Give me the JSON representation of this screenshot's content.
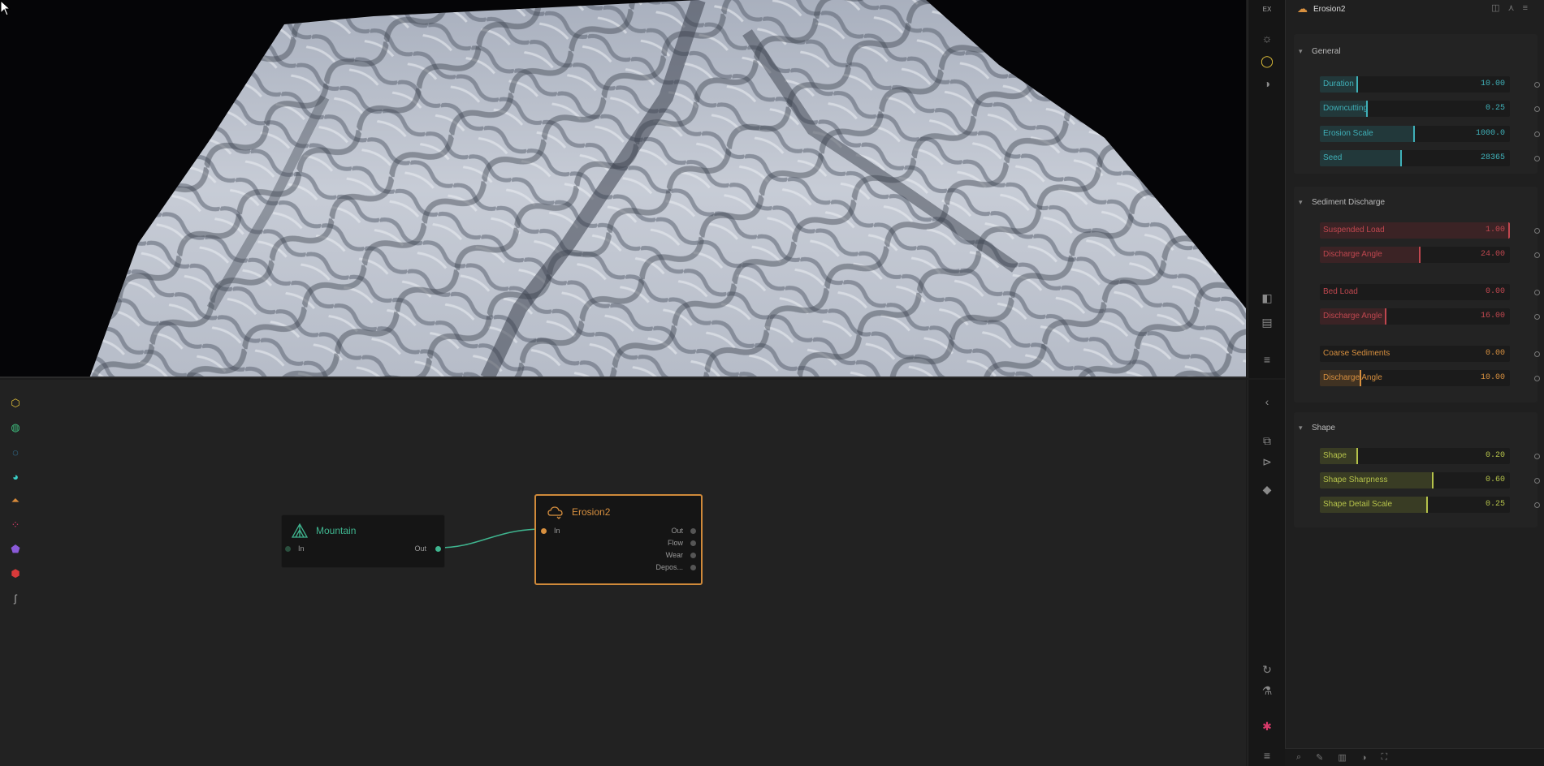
{
  "viewport": {
    "corner_label": "EX"
  },
  "graph": {
    "nodes": {
      "mountain": {
        "title": "Mountain",
        "in_label": "In",
        "out_label": "Out"
      },
      "erosion": {
        "title": "Erosion2",
        "in_label": "In",
        "outputs": [
          "Out",
          "Flow",
          "Wear",
          "Depos..."
        ]
      }
    },
    "left_tools": [
      {
        "icon": "cube-icon",
        "color": "#e3c23a"
      },
      {
        "icon": "globe-icon",
        "color": "#3fbf7f"
      },
      {
        "icon": "swirl-icon",
        "color": "#3aa0d8"
      },
      {
        "icon": "palette-icon",
        "color": "#3ad0c8"
      },
      {
        "icon": "mountain-layers-icon",
        "color": "#d88a3a"
      },
      {
        "icon": "scatter-icon",
        "color": "#d83a6a"
      },
      {
        "icon": "shield-icon",
        "color": "#8a5ad8"
      },
      {
        "icon": "gem-icon",
        "color": "#d83a3a"
      },
      {
        "icon": "curve-icon",
        "color": "#aaaaaa"
      }
    ]
  },
  "props": {
    "header": {
      "title": "Erosion2"
    },
    "sections": [
      {
        "title": "General",
        "rows": [
          {
            "label": "Duration",
            "value": "10.00",
            "fill": 0.2,
            "color": "#3fb0b8"
          },
          {
            "label": "Downcutting",
            "value": "0.25",
            "fill": 0.25,
            "color": "#3fb0b8"
          },
          {
            "label": "Erosion Scale",
            "value": "1000.0",
            "fill": 0.5,
            "color": "#3fb0b8"
          },
          {
            "label": "Seed",
            "value": "28365",
            "fill": 0.43,
            "color": "#3fb0b8"
          }
        ]
      },
      {
        "title": "Sediment Discharge",
        "rows": [
          {
            "label": "Suspended Load",
            "value": "1.00",
            "fill": 1.0,
            "color": "#c0474f"
          },
          {
            "label": "Discharge Angle",
            "value": "24.00",
            "fill": 0.53,
            "color": "#c0474f"
          },
          {
            "label": "Bed Load",
            "value": "0.00",
            "fill": 0.0,
            "color": "#c0474f"
          },
          {
            "label": "Discharge Angle",
            "value": "16.00",
            "fill": 0.35,
            "color": "#c0474f"
          },
          {
            "label": "Coarse Sediments",
            "value": "0.00",
            "fill": 0.0,
            "color": "#d8903f"
          },
          {
            "label": "Discharge Angle",
            "value": "10.00",
            "fill": 0.22,
            "color": "#d8903f"
          }
        ]
      },
      {
        "title": "Shape",
        "rows": [
          {
            "label": "Shape",
            "value": "0.20",
            "fill": 0.2,
            "color": "#b5c24a"
          },
          {
            "label": "Shape Sharpness",
            "value": "0.60",
            "fill": 0.6,
            "color": "#b5c24a"
          },
          {
            "label": "Shape Detail Scale",
            "value": "0.25",
            "fill": 0.57,
            "color": "#b5c24a"
          }
        ]
      }
    ]
  }
}
